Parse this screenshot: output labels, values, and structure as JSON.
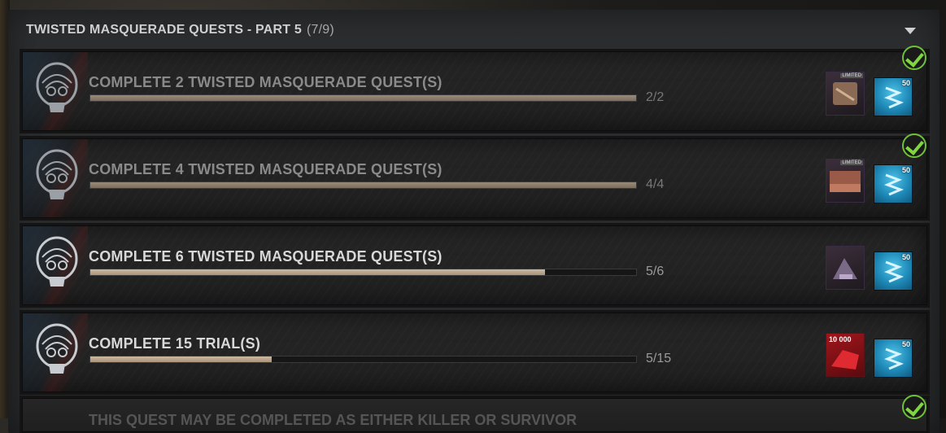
{
  "header": {
    "title": "TWISTED MASQUERADE QUESTS - PART 5",
    "count": "(7/9)"
  },
  "quests": [
    {
      "title": "COMPLETE 2 TWISTED MASQUERADE QUEST(S)",
      "progress": "2/2",
      "fraction": 1.0,
      "completed": true,
      "rewards": [
        {
          "type": "item",
          "icon": "cosmetic-item-icon",
          "tag": "LIMITED"
        },
        {
          "type": "shards",
          "icon": "iridescent-shards-icon",
          "amount": "50"
        }
      ]
    },
    {
      "title": "COMPLETE 4 TWISTED MASQUERADE QUEST(S)",
      "progress": "4/4",
      "fraction": 1.0,
      "completed": true,
      "rewards": [
        {
          "type": "item",
          "icon": "cosmetic-item-icon",
          "tag": "LIMITED"
        },
        {
          "type": "shards",
          "icon": "iridescent-shards-icon",
          "amount": "50"
        }
      ]
    },
    {
      "title": "COMPLETE 6 TWISTED MASQUERADE QUEST(S)",
      "progress": "5/6",
      "fraction": 0.833,
      "completed": false,
      "rewards": [
        {
          "type": "item",
          "icon": "cosmetic-item-icon"
        },
        {
          "type": "shards",
          "icon": "iridescent-shards-icon",
          "amount": "50"
        }
      ]
    },
    {
      "title": "COMPLETE 15 TRIAL(S)",
      "progress": "5/15",
      "fraction": 0.333,
      "completed": false,
      "rewards": [
        {
          "type": "bloodpoints",
          "icon": "bloodpoints-icon",
          "amount": "10 000"
        },
        {
          "type": "shards",
          "icon": "iridescent-shards-icon",
          "amount": "50"
        }
      ]
    }
  ],
  "partial_quest": {
    "title": "THIS QUEST MAY BE COMPLETED AS EITHER KILLER OR SURVIVOR",
    "completed": true
  },
  "colors": {
    "progress_fill": "#cdb9a0",
    "check": "#7fd63f",
    "shards": "#4fc3e8",
    "bloodpoints": "#a0161c"
  }
}
